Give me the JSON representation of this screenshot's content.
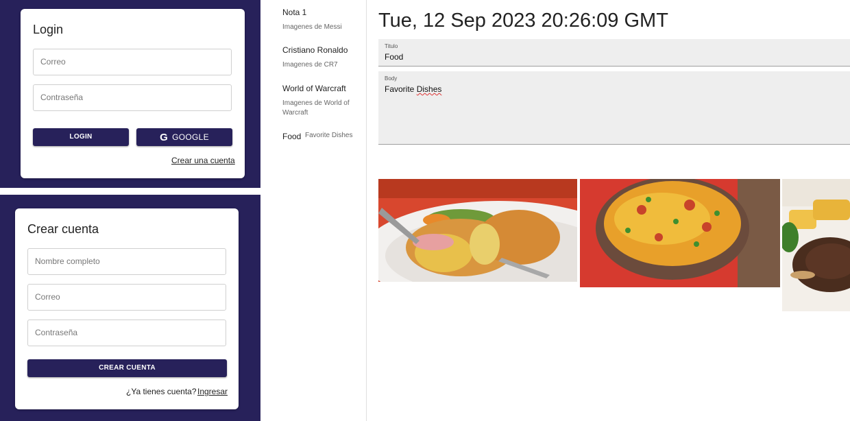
{
  "login": {
    "title": "Login",
    "email_placeholder": "Correo",
    "password_placeholder": "Contraseña",
    "login_button": "LOGIN",
    "google_button": "GOOGLE",
    "create_account_link": "Crear una cuenta"
  },
  "signup": {
    "title": "Crear cuenta",
    "name_placeholder": "Nombre completo",
    "email_placeholder": "Correo",
    "password_placeholder": "Contraseña",
    "submit_button": "CREAR CUENTA",
    "have_account_text": "¿Ya tienes cuenta?",
    "login_link": "Ingresar"
  },
  "notes": [
    {
      "title": "Nota 1",
      "subtitle": "Imagenes de Messi"
    },
    {
      "title": "Cristiano Ronaldo",
      "subtitle": "Imagenes de CR7"
    },
    {
      "title": "World of Warcraft",
      "subtitle": "Imagenes de World of Warcraft"
    },
    {
      "title": "Food",
      "subtitle": "Favorite Dishes"
    }
  ],
  "editor": {
    "date": "Tue, 12 Sep 2023 20:26:09 GMT",
    "title_label": "Titulo",
    "title_value": "Food",
    "body_label": "Body",
    "body_word1": "Favorite ",
    "body_word2": "Dishes"
  },
  "images": [
    {
      "name": "cordon-bleu-image"
    },
    {
      "name": "paella-image"
    },
    {
      "name": "steak-image"
    }
  ],
  "colors": {
    "brand": "#27215a",
    "field_bg": "#eeeeee"
  }
}
